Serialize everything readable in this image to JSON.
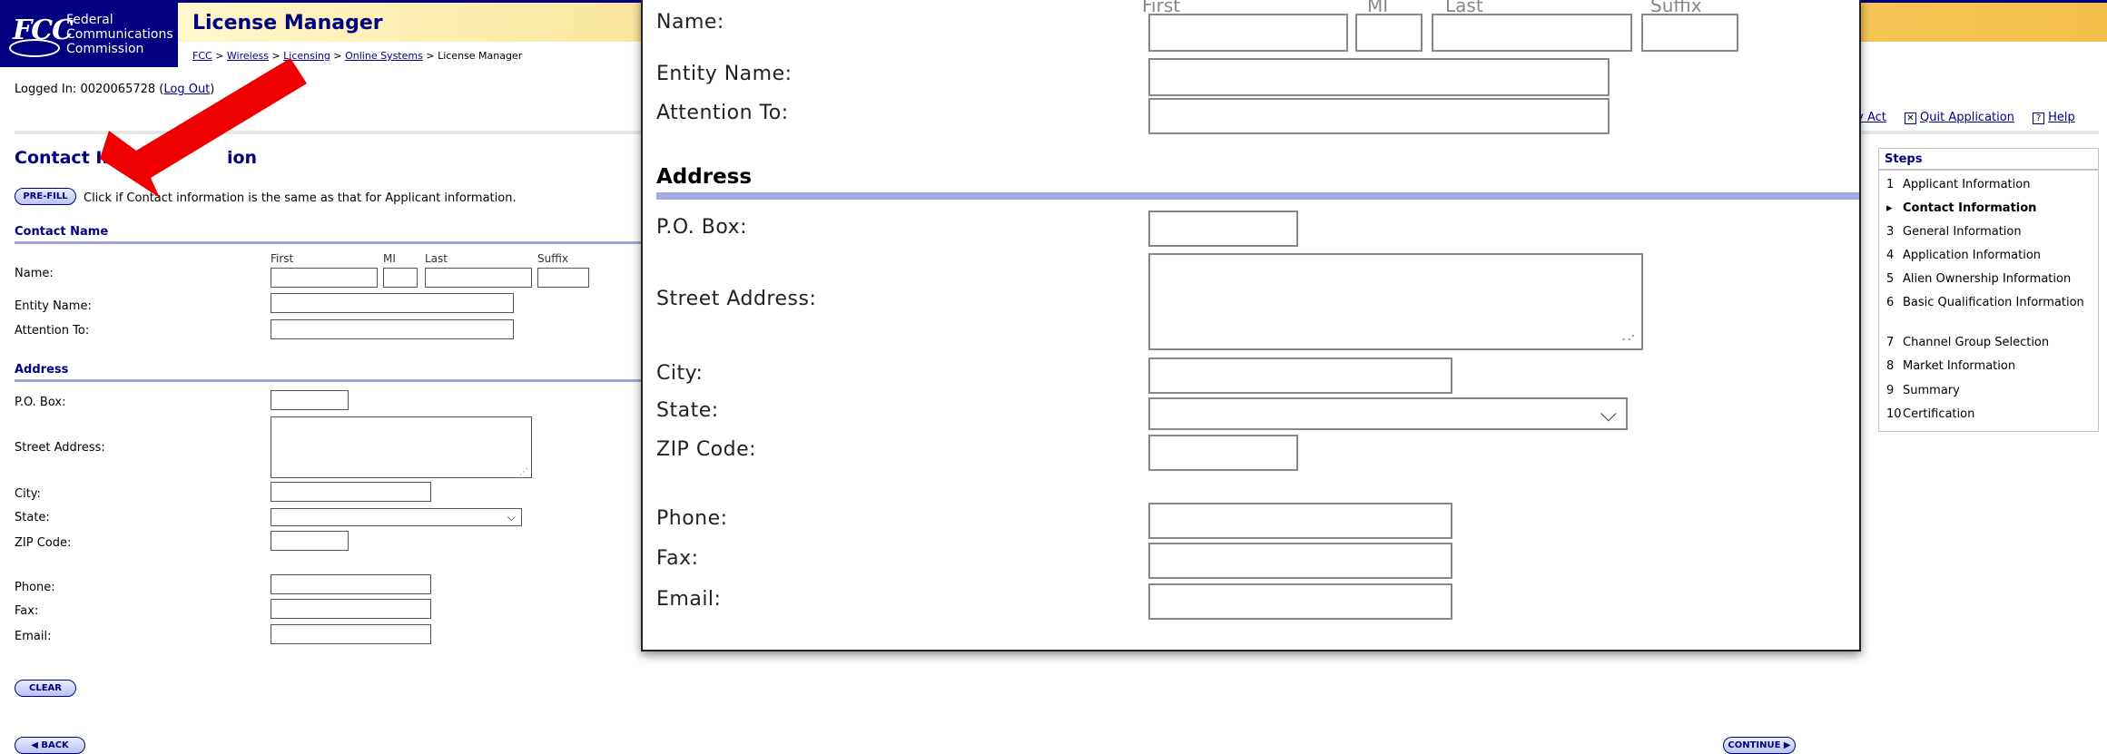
{
  "header": {
    "logo_text": "FCC",
    "agency_line1": "Federal",
    "agency_line2": "Communications",
    "agency_line3": "Commission",
    "app_title": "License Manager",
    "breadcrumb": [
      "FCC",
      "Wireless",
      "Licensing",
      "Online Systems",
      "License Manager"
    ],
    "breadcrumb_sep": ">",
    "logged_in_prefix": "Logged In: 0020065728 (",
    "logout_label": "Log Out",
    "logged_in_suffix": ")"
  },
  "toplinks": {
    "privacy_label": "acy Act",
    "quit_label": "Quit Application",
    "help_label": "Help",
    "quit_icon": "x-icon",
    "help_icon": "question-icon"
  },
  "page": {
    "title": "Contact In",
    "title_tail": "ion",
    "prefill_button": "PRE-FILL",
    "prefill_text": "Click if Contact information is the same as that for Applicant information.",
    "contact_name_heading": "Contact Name",
    "name_label": "Name:",
    "first_label": "First",
    "mi_label": "MI",
    "last_label": "Last",
    "suffix_label": "Suffix",
    "entity_label": "Entity Name:",
    "attention_label": "Attention To:",
    "address_heading": "Address",
    "pobox_label": "P.O. Box:",
    "street_label": "Street Address:",
    "city_label": "City:",
    "state_label": "State:",
    "zip_label": "ZIP Code:",
    "phone_label": "Phone:",
    "fax_label": "Fax:",
    "email_label": "Email:",
    "clear_button": "CLEAR",
    "back_button": "◀ BACK",
    "continue_button": "CONTINUE ▶"
  },
  "fields": {
    "first": "",
    "mi": "",
    "last": "",
    "suffix": "",
    "entity": "",
    "attention": "",
    "pobox": "",
    "street": "",
    "city": "",
    "state": "",
    "zip": "",
    "phone": "",
    "fax": "",
    "email": ""
  },
  "steps": {
    "heading": "Steps",
    "items": [
      {
        "num": "1",
        "label": "Applicant Information"
      },
      {
        "num": "",
        "label": "Contact Information",
        "active": true
      },
      {
        "num": "3",
        "label": "General Information"
      },
      {
        "num": "4",
        "label": "Application Information"
      },
      {
        "num": "5",
        "label": "Alien Ownership Information"
      },
      {
        "num": "6",
        "label": "Basic Qualification Information"
      },
      {
        "num": "7",
        "label": "Channel Group Selection"
      },
      {
        "num": "8",
        "label": "Market Information"
      },
      {
        "num": "9",
        "label": "Summary"
      },
      {
        "num": "10",
        "label": "Certification"
      }
    ]
  },
  "colors": {
    "navy": "#000080",
    "rule": "#9ea6e0",
    "banner": "#f3c04a",
    "arrow": "#ee0000"
  }
}
